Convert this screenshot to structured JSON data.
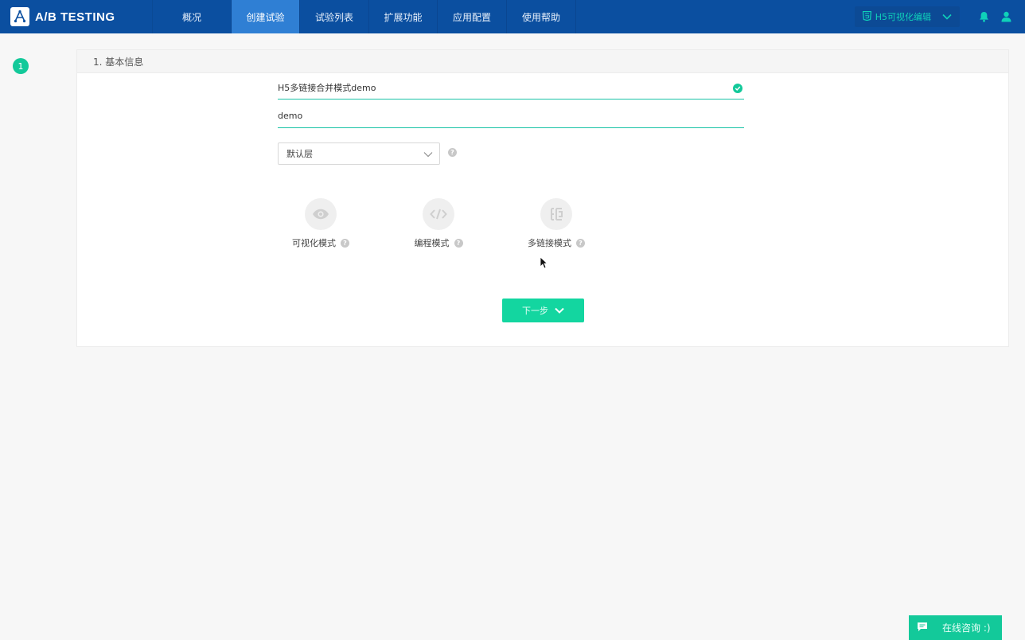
{
  "app": {
    "logo_text": "A/B TESTING"
  },
  "nav": {
    "items": [
      {
        "label": "概况",
        "active": false
      },
      {
        "label": "创建试验",
        "active": true
      },
      {
        "label": "试验列表",
        "active": false
      },
      {
        "label": "扩展功能",
        "active": false
      },
      {
        "label": "应用配置",
        "active": false
      },
      {
        "label": "使用帮助",
        "active": false
      }
    ],
    "mode_switch_label": "H5可视化编辑",
    "icons": [
      "html5-icon",
      "chevron-down-icon",
      "bell-icon",
      "user-icon"
    ]
  },
  "step": {
    "number": "1"
  },
  "section": {
    "title": "1. 基本信息",
    "name_value": "H5多链接合并模式demo",
    "desc_value": "demo",
    "layer_select": "默认层",
    "help_mark": "?",
    "modes": [
      {
        "label": "可视化模式",
        "icon": "eye-icon"
      },
      {
        "label": "编程模式",
        "icon": "code-icon"
      },
      {
        "label": "多链接模式",
        "icon": "multilink-icon"
      }
    ],
    "next_label": "下一步"
  },
  "chat": {
    "label": "在线咨询 :)"
  },
  "colors": {
    "nav_bg": "#0b4fa0",
    "nav_active": "#2f7fd4",
    "accent": "#13c99a",
    "button": "#13d6a0"
  }
}
